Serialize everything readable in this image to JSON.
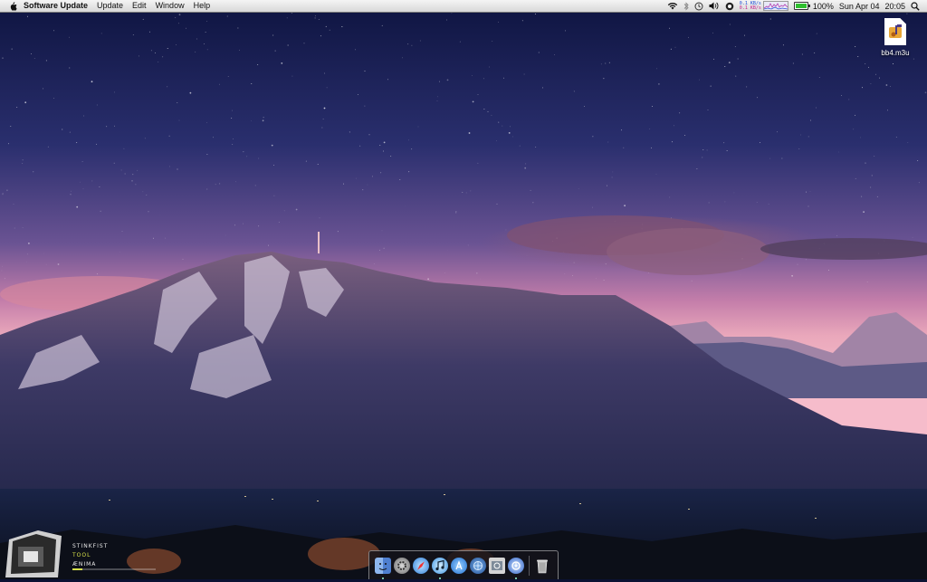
{
  "menubar": {
    "app_name": "Software Update",
    "menus": [
      "Update",
      "Edit",
      "Window",
      "Help"
    ],
    "net_down": "0.1 KB/s",
    "net_up": "0.1 KB/s",
    "battery_percent": "100%",
    "battery_level": 1.0,
    "date": "Sun Apr 04",
    "time": "20:05",
    "icons": [
      "apple-icon",
      "wifi-icon",
      "bluetooth-icon",
      "time-machine-icon",
      "volume-icon",
      "sync-icon",
      "battery-icon",
      "spotlight-icon"
    ]
  },
  "desktop": {
    "file_name": "bb4.m3u",
    "file_icon": "playlist-file-icon"
  },
  "widget": {
    "track": "STINKFIST",
    "artist": "TOOL",
    "album": "ÆNIMA",
    "progress": 0.12,
    "accent": "#d6e04a"
  },
  "dock": {
    "apps": [
      {
        "name": "finder-icon",
        "color": "#5f8fd8",
        "running": true
      },
      {
        "name": "system-preferences-icon",
        "color": "#8a8a8a",
        "running": false
      },
      {
        "name": "safari-icon",
        "color": "#3a8fe0",
        "running": false
      },
      {
        "name": "itunes-icon",
        "color": "#4aa2e8",
        "running": true
      },
      {
        "name": "app-store-icon",
        "color": "#2d7fd6",
        "running": false
      },
      {
        "name": "network-icon",
        "color": "#2f6fb8",
        "running": false
      },
      {
        "name": "preview-icon",
        "color": "#c8c8c8",
        "running": false
      },
      {
        "name": "software-update-icon",
        "color": "#3b6fd0",
        "running": true
      }
    ],
    "trash": "trash-icon"
  }
}
